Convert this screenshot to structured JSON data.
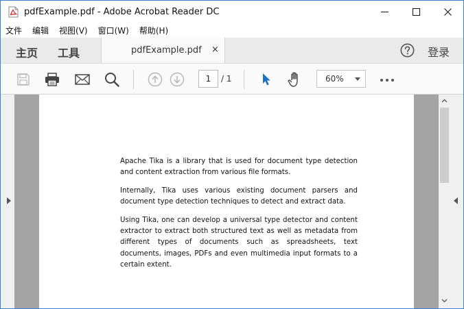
{
  "window": {
    "title": "pdfExample.pdf - Adobe Acrobat Reader DC"
  },
  "menu": {
    "items": [
      {
        "label": "文件"
      },
      {
        "label": "编辑"
      },
      {
        "label": "视图(V)"
      },
      {
        "label": "窗口(W)"
      },
      {
        "label": "帮助(H)"
      }
    ]
  },
  "tabs": {
    "home": "主页",
    "tools": "工具",
    "document": "pdfExample.pdf",
    "close": "×",
    "signin": "登录"
  },
  "toolbar": {
    "page_current": "1",
    "page_total": "/ 1",
    "zoom": "60%"
  },
  "document": {
    "paragraphs": [
      "Apache Tika is a library that is used for document type detection and content extraction from various file formats.",
      "Internally, Tika uses various existing document parsers and document type detection techniques to detect and extract data.",
      "Using Tika, one can develop a universal type detector and content extractor to extract both structured text as well as metadata from different types of documents such as spreadsheets, text documents, images, PDFs and even multimedia input formats to a certain extent."
    ]
  },
  "colors": {
    "accent": "#3c82c8",
    "select_tool": "#1a73c8",
    "canvas": "#a4a4a4"
  },
  "icons": {
    "app": "pdf-file-icon",
    "save": "save-icon",
    "print": "printer-icon",
    "email": "envelope-icon",
    "search": "search-icon",
    "prev_page": "arrow-up-circle-icon",
    "next_page": "arrow-down-circle-icon",
    "select": "cursor-arrow-icon",
    "hand": "hand-icon",
    "more": "more-dots-icon",
    "help": "help-icon"
  }
}
